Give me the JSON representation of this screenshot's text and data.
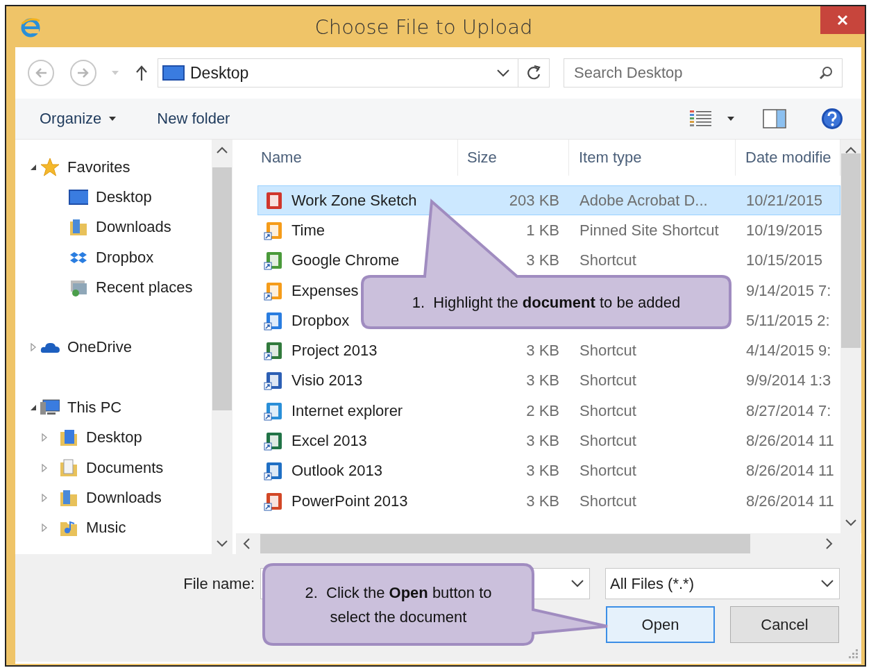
{
  "window": {
    "title": "Choose File to Upload"
  },
  "address": {
    "location": "Desktop"
  },
  "search": {
    "placeholder": "Search Desktop"
  },
  "toolbar": {
    "organize": "Organize",
    "new_folder": "New folder"
  },
  "navigation": [
    {
      "label": "Favorites",
      "expanded": true,
      "children": [
        {
          "label": "Desktop"
        },
        {
          "label": "Downloads"
        },
        {
          "label": "Dropbox"
        },
        {
          "label": "Recent places"
        }
      ]
    },
    {
      "label": "OneDrive",
      "expanded": false
    },
    {
      "label": "This PC",
      "expanded": true,
      "children": [
        {
          "label": "Desktop",
          "expanded": false
        },
        {
          "label": "Documents",
          "expanded": false
        },
        {
          "label": "Downloads",
          "expanded": false
        },
        {
          "label": "Music",
          "expanded": false
        }
      ]
    }
  ],
  "file_list": {
    "columns": [
      "Name",
      "Size",
      "Item type",
      "Date modifie"
    ],
    "rows": [
      {
        "name": "Work Zone Sketch",
        "size": "203 KB",
        "type": "Adobe Acrobat D...",
        "date": "10/21/2015",
        "selected": true
      },
      {
        "name": "Time",
        "size": "1 KB",
        "type": "Pinned Site Shortcut",
        "date": "10/19/2015",
        "selected": false
      },
      {
        "name": "Google Chrome",
        "size": "3 KB",
        "type": "Shortcut",
        "date": "10/15/2015",
        "selected": false
      },
      {
        "name": "Expenses",
        "date": "9/14/2015 7:",
        "selected": false
      },
      {
        "name": "Dropbox",
        "date": "5/11/2015 2:",
        "selected": false
      },
      {
        "name": "Project 2013",
        "size": "3 KB",
        "type": "Shortcut",
        "date": "4/14/2015 9:",
        "selected": false
      },
      {
        "name": "Visio 2013",
        "size": "3 KB",
        "type": "Shortcut",
        "date": "9/9/2014 1:3",
        "selected": false
      },
      {
        "name": "Internet explorer",
        "size": "2 KB",
        "type": "Shortcut",
        "date": "8/27/2014 7:",
        "selected": false
      },
      {
        "name": "Excel 2013",
        "size": "3 KB",
        "type": "Shortcut",
        "date": "8/26/2014 11",
        "selected": false
      },
      {
        "name": "Outlook 2013",
        "size": "3 KB",
        "type": "Shortcut",
        "date": "8/26/2014 11",
        "selected": false
      },
      {
        "name": "PowerPoint 2013",
        "size": "3 KB",
        "type": "Shortcut",
        "date": "8/26/2014 11",
        "selected": false
      }
    ]
  },
  "footer": {
    "file_name_label": "File name:",
    "file_type": "All Files (*.*)",
    "buttons": [
      {
        "label": "Open",
        "default": true
      },
      {
        "label": "Cancel",
        "default": false
      }
    ]
  },
  "callouts": [
    {
      "text": "1.  Highlight the **document** to be added"
    },
    {
      "text": "2.  Click the **Open** button to select the document"
    }
  ]
}
